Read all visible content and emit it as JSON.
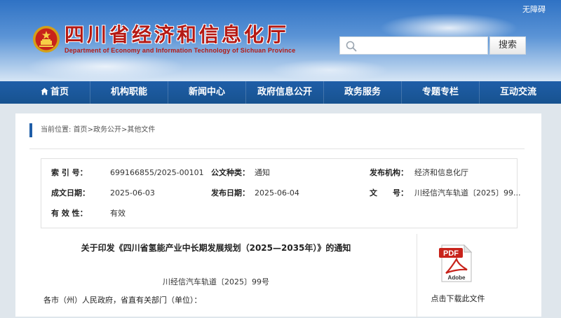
{
  "header": {
    "accessibility_label": "无障碍",
    "site_title_cn": "四川省经济和信息化厅",
    "site_title_en": "Department of Economy and Information Technology of Sichuan Province",
    "search": {
      "placeholder": "",
      "value": "",
      "button_label": "搜索",
      "icon": "search-icon"
    },
    "emblem_icon": "national-emblem-icon"
  },
  "nav": {
    "items": [
      {
        "label": "首页",
        "icon": "home-icon"
      },
      {
        "label": "机构职能"
      },
      {
        "label": "新闻中心"
      },
      {
        "label": "政府信息公开"
      },
      {
        "label": "政务服务"
      },
      {
        "label": "专题专栏"
      },
      {
        "label": "互动交流"
      }
    ]
  },
  "breadcrumb": {
    "prefix": "当前位置:",
    "items": [
      "首页",
      ">",
      "政务公开",
      ">",
      "其他文件"
    ]
  },
  "meta": {
    "index_label": "索 引 号：",
    "index_value": "699166855/2025-00101",
    "category_label": "公文种类：",
    "category_value": "通知",
    "publisher_label": "发布机构：",
    "publisher_value": "经济和信息化厅",
    "created_label": "成文日期：",
    "created_value": "2025-06-03",
    "published_label": "发布日期：",
    "published_value": "2025-06-04",
    "docno_label": "文　　号：",
    "docno_value": "川经信汽车轨道〔2025〕99...",
    "validity_label": "有 效 性：",
    "validity_value": "有效"
  },
  "article": {
    "title": "关于印发《四川省氢能产业中长期发展规划（2025—2035年）》的通知",
    "doc_number": "川经信汽车轨道〔2025〕99号",
    "salutation": "各市（州）人民政府，省直有关部门（单位）："
  },
  "download": {
    "icon": "pdf-file-icon",
    "pdf_text": "PDF",
    "adobe_text": "Adobe",
    "label": "点击下载此文件"
  },
  "colors": {
    "nav_bg": "#1f5ea8",
    "title_red": "#b51a14",
    "header_sky": "#5b94d6"
  }
}
